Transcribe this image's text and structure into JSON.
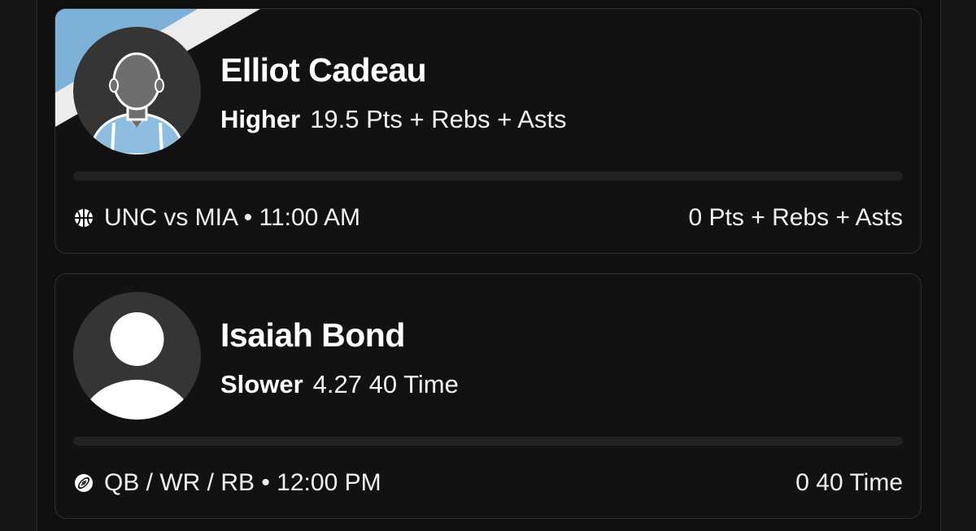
{
  "picks": [
    {
      "player_name": "Elliot Cadeau",
      "direction": "Higher",
      "line": "19.5 Pts + Rebs + Asts",
      "matchup": "UNC vs MIA • 11:00 AM",
      "current": "0 Pts + Rebs + Asts",
      "progress_fraction": 0,
      "sport_icon": "basketball-icon",
      "team_colors": [
        "#7eb1d8",
        "#ececec"
      ]
    },
    {
      "player_name": "Isaiah Bond",
      "direction": "Slower",
      "line": "4.27 40 Time",
      "matchup": "QB / WR / RB • 12:00 PM",
      "current": "0 40 Time",
      "progress_fraction": 0,
      "sport_icon": "football-icon"
    }
  ]
}
